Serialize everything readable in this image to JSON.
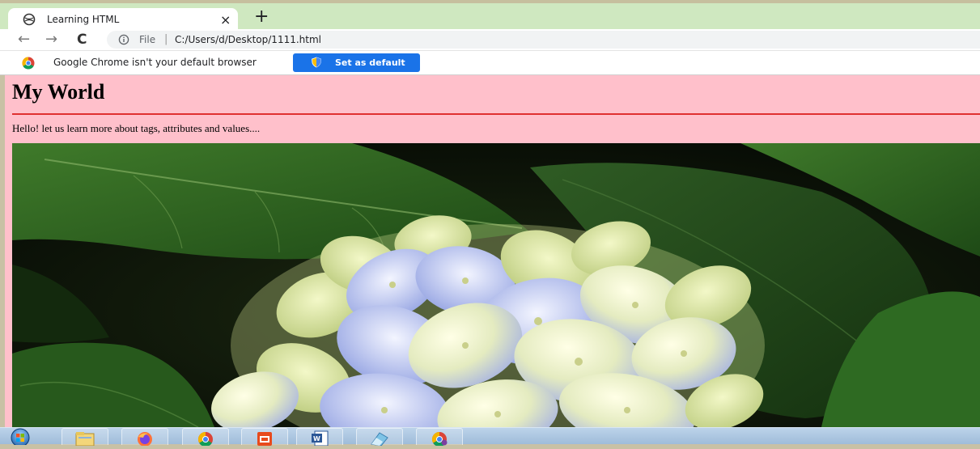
{
  "browser": {
    "tab": {
      "title": "Learning HTML",
      "close_glyph": "×",
      "favicon": "globe-icon"
    },
    "new_tab_glyph": "+",
    "nav": {
      "back_glyph": "←",
      "forward_glyph": "→",
      "reload_glyph": "C"
    },
    "address": {
      "scheme_label": "File",
      "separator": "|",
      "url": "C:/Users/d/Desktop/1111.html"
    },
    "infobar": {
      "message": "Google Chrome isn't your default browser",
      "button_label": "Set as default"
    }
  },
  "page": {
    "heading": "My World",
    "paragraph": "Hello! let us learn more about tags, attributes and values....",
    "background": "#ffc0cb",
    "rule_color": "#e03030",
    "image": "hydrangea-photo"
  },
  "taskbar": {
    "items": [
      "start-orb-icon",
      "file-explorer-icon",
      "firefox-icon",
      "chrome-icon",
      "foxit-reader-icon",
      "word-icon",
      "eraser-app-icon",
      "chrome-canary-icon"
    ]
  }
}
